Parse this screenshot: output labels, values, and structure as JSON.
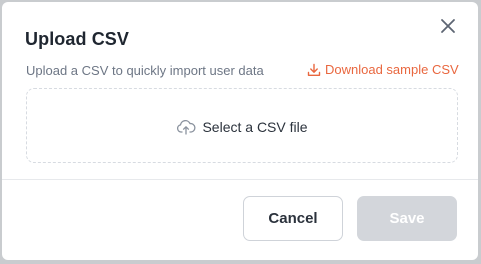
{
  "dialog": {
    "title": "Upload CSV",
    "subtitle": "Upload a CSV to quickly import user data",
    "download_link": "Download sample CSV",
    "close_icon": "close-icon",
    "dropzone": {
      "label": "Select a CSV file",
      "icon": "cloud-upload-icon"
    },
    "buttons": {
      "cancel": "Cancel",
      "save": "Save",
      "save_disabled": true
    }
  },
  "colors": {
    "accent": "#e9673f",
    "text_primary": "#1f2630",
    "text_muted": "#6d7685",
    "disabled_button": "#d3d6db"
  }
}
